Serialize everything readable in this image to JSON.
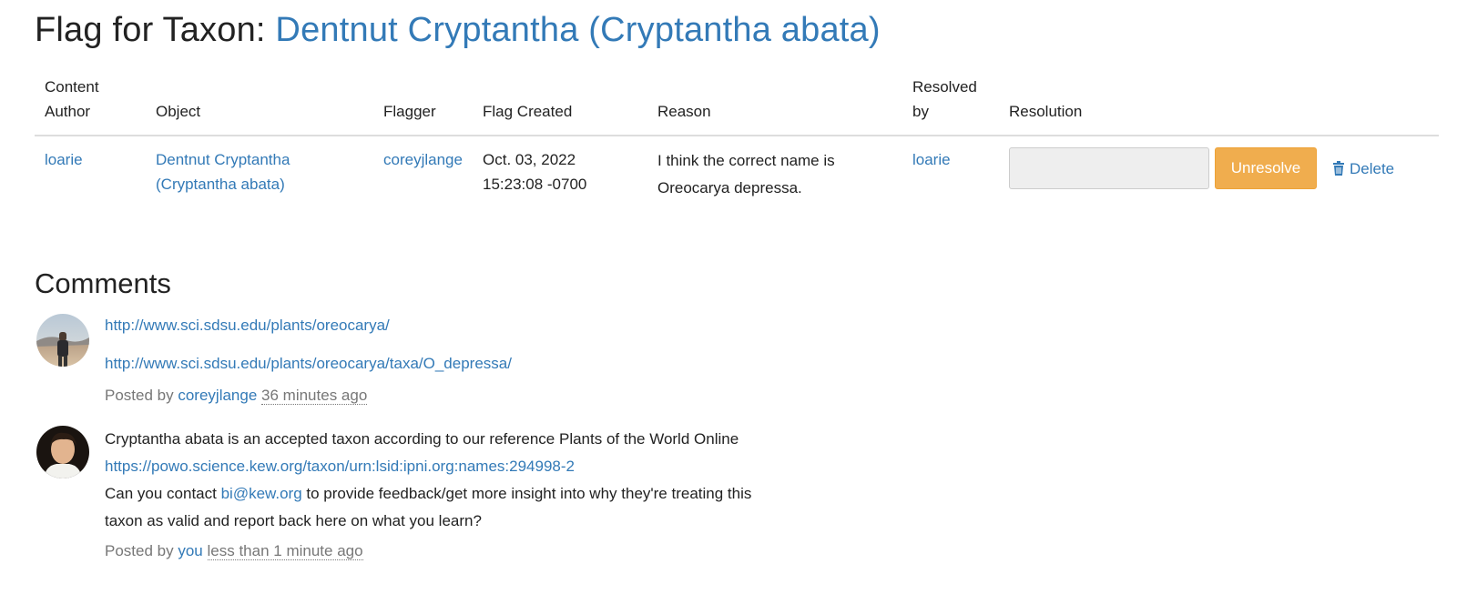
{
  "page": {
    "title_prefix": "Flag for Taxon:",
    "title_link": "Dentnut Cryptantha (Cryptantha abata)"
  },
  "table": {
    "headers": {
      "content_author": "Content Author",
      "object": "Object",
      "flagger": "Flagger",
      "flag_created": "Flag Created",
      "reason": "Reason",
      "resolved_by": "Resolved by",
      "resolution": "Resolution"
    },
    "row": {
      "content_author": "loarie",
      "object": "Dentnut Cryptantha (Cryptantha abata)",
      "flagger": "coreyjlange",
      "flag_created_date": "Oct. 03, 2022",
      "flag_created_time": "15:23:08 -0700",
      "reason": "I think the correct name is Oreocarya depressa.",
      "resolved_by": "loarie",
      "resolution_value": "",
      "unresolve_label": "Unresolve",
      "delete_label": "Delete"
    }
  },
  "comments": {
    "heading": "Comments",
    "items": [
      {
        "link1": "http://www.sci.sdsu.edu/plants/oreocarya/",
        "link2": "http://www.sci.sdsu.edu/plants/oreocarya/taxa/O_depressa/",
        "posted_by_label": "Posted by",
        "author": "coreyjlange",
        "time": "36 minutes ago"
      },
      {
        "text1": "Cryptantha abata is an accepted taxon according to our reference Plants of the World Online",
        "link": "https://powo.science.kew.org/taxon/urn:lsid:ipni.org:names:294998-2",
        "text2": "Can you contact",
        "email": "bi@kew.org",
        "text3": "to provide feedback/get more insight into why they're treating this taxon as valid and report back here on what you learn?",
        "posted_by_label": "Posted by",
        "author": "you",
        "time": "less than 1 minute ago"
      }
    ]
  },
  "colors": {
    "link": "#337ab7",
    "warning_button": "#f0ad4e",
    "muted_text": "#777777"
  }
}
